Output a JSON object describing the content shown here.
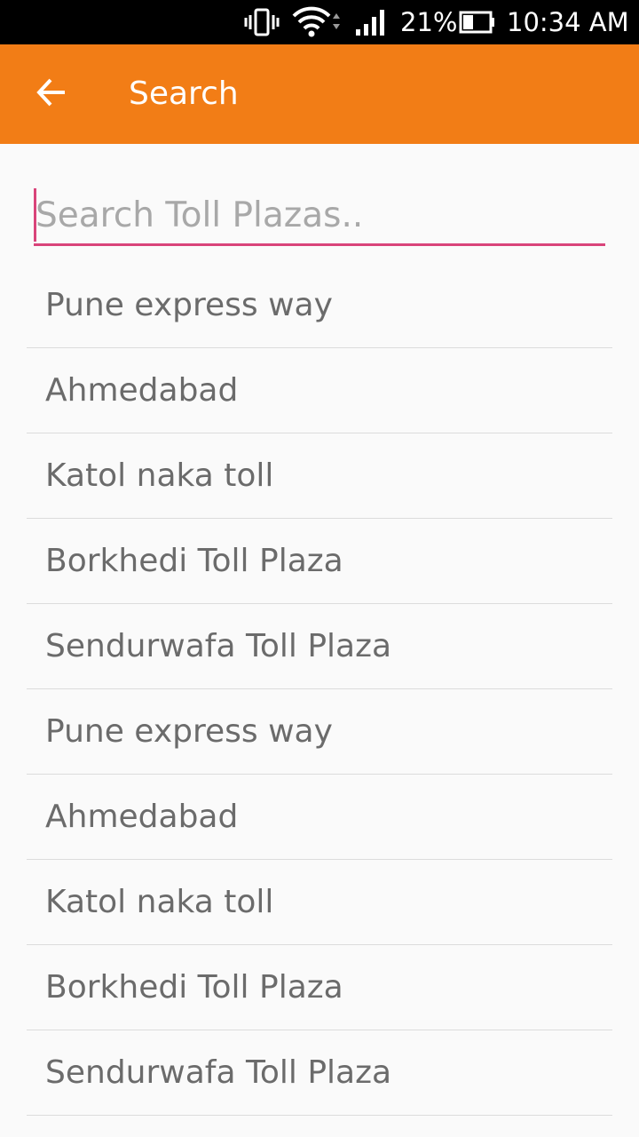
{
  "status_bar": {
    "battery_percent": "21%",
    "time": "10:34 AM",
    "icons": [
      "vibrate-icon",
      "wifi-icon",
      "signal-icon",
      "battery-icon"
    ]
  },
  "app_bar": {
    "title": "Search",
    "back_icon": "arrow-back-icon",
    "color": "#f27d16"
  },
  "search": {
    "placeholder": "Search Toll Plazas..",
    "value": "",
    "accent_color": "#d9447a"
  },
  "results": [
    {
      "label": "Pune express way"
    },
    {
      "label": "Ahmedabad"
    },
    {
      "label": "Katol naka toll"
    },
    {
      "label": "Borkhedi Toll Plaza"
    },
    {
      "label": "Sendurwafa Toll Plaza"
    },
    {
      "label": "Pune express way"
    },
    {
      "label": "Ahmedabad"
    },
    {
      "label": "Katol naka toll"
    },
    {
      "label": "Borkhedi Toll Plaza"
    },
    {
      "label": "Sendurwafa Toll Plaza"
    }
  ]
}
